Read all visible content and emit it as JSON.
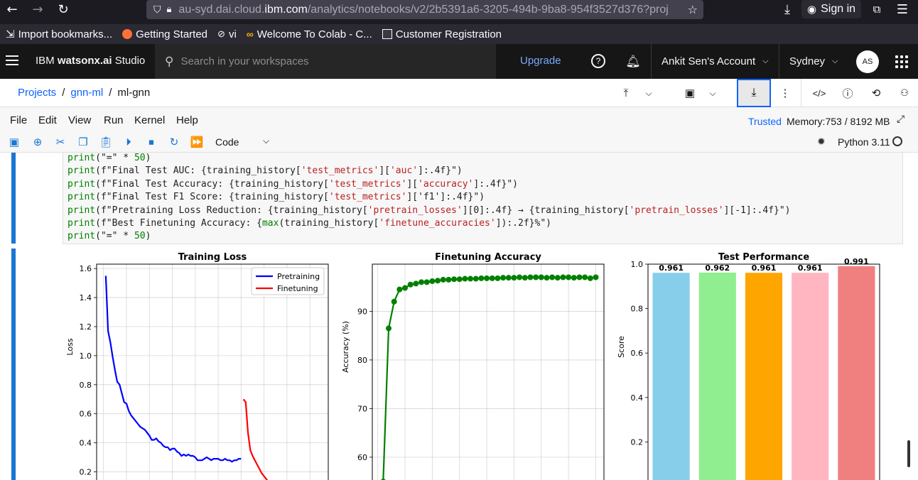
{
  "browser": {
    "url_host": "au-syd.dai.cloud.",
    "url_domain": "ibm.com",
    "url_path": "/analytics/notebooks/v2/2b5391a6-3205-494b-9ba8-954f3527d376?projec",
    "signin": "Sign in"
  },
  "bookmarks": [
    {
      "label": "Import bookmarks..."
    },
    {
      "label": "Getting Started"
    },
    {
      "label": "vi"
    },
    {
      "label": "Welcome To Colab - C..."
    },
    {
      "label": "Customer Registration"
    }
  ],
  "header": {
    "brand_prefix": "IBM ",
    "brand_bold": "watsonx.ai",
    "brand_suffix": " Studio",
    "search_placeholder": "Search in your workspaces",
    "upgrade": "Upgrade",
    "account": "Ankit Sen's Account",
    "region": "Sydney",
    "avatar": "AS"
  },
  "breadcrumb": {
    "items": [
      "Projects",
      "gnn-ml",
      "ml-gnn"
    ]
  },
  "menu": {
    "items": [
      "File",
      "Edit",
      "View",
      "Run",
      "Kernel",
      "Help"
    ],
    "trusted": "Trusted",
    "memory": "Memory:753 / 8192 MB"
  },
  "toolbar": {
    "cell_type": "Code",
    "kernel": "Python 3.11"
  },
  "code_lines": [
    "print(\"=\" * 50)",
    "print(f\"Final Test AUC: {training_history['test_metrics']['auc']:.4f}\")",
    "print(f\"Final Test Accuracy: {training_history['test_metrics']['accuracy']:.4f}\")",
    "print(f\"Final Test F1 Score: {training_history['test_metrics']['f1']:.4f}\")",
    "print(f\"Pretraining Loss Reduction: {training_history['pretrain_losses'][0]:.4f} → {training_history['pretrain_losses'][-1]:.4f}\")",
    "print(f\"Best Finetuning Accuracy: {max(training_history['finetune_accuracies']):.2f}%\")",
    "print(\"=\" * 50)"
  ],
  "chart_data": [
    {
      "type": "line",
      "title": "Training Loss",
      "ylabel": "Loss",
      "xlabel": "",
      "ylim": [
        0.1,
        1.63
      ],
      "yticks": [
        0.2,
        0.4,
        0.6,
        0.8,
        1.0,
        1.2,
        1.4,
        1.6
      ],
      "legend": "top-right",
      "grid": true,
      "series": [
        {
          "name": "Pretraining",
          "color": "#0000ff",
          "x": [
            1,
            2,
            3,
            4,
            5,
            6,
            7,
            8,
            9,
            10,
            11,
            12,
            13,
            14,
            15,
            16,
            17,
            18,
            19,
            20,
            21,
            22,
            23,
            24,
            25,
            26,
            27,
            28,
            29,
            30,
            31,
            32,
            33,
            34,
            35,
            36,
            37,
            38,
            39,
            40,
            41,
            42,
            43,
            44,
            45,
            46,
            47,
            48,
            49,
            50,
            51,
            52,
            53,
            54,
            55,
            56,
            57,
            58,
            59,
            60
          ],
          "values": [
            1.55,
            1.17,
            1.09,
            0.99,
            0.9,
            0.82,
            0.8,
            0.74,
            0.68,
            0.67,
            0.62,
            0.59,
            0.57,
            0.55,
            0.53,
            0.51,
            0.5,
            0.49,
            0.47,
            0.45,
            0.42,
            0.42,
            0.43,
            0.41,
            0.4,
            0.38,
            0.37,
            0.37,
            0.35,
            0.36,
            0.36,
            0.34,
            0.33,
            0.31,
            0.32,
            0.31,
            0.32,
            0.31,
            0.31,
            0.3,
            0.28,
            0.28,
            0.28,
            0.29,
            0.3,
            0.29,
            0.28,
            0.29,
            0.29,
            0.29,
            0.28,
            0.28,
            0.29,
            0.28,
            0.28,
            0.27,
            0.28,
            0.28,
            0.29,
            0.29
          ]
        },
        {
          "name": "Finetuning",
          "color": "#ff0000",
          "x": [
            61,
            62,
            63,
            64,
            65,
            66,
            67,
            68,
            69,
            70,
            71,
            72,
            73
          ],
          "values": [
            0.7,
            0.68,
            0.47,
            0.35,
            0.31,
            0.28,
            0.25,
            0.22,
            0.19,
            0.17,
            0.15,
            0.13,
            0.12
          ]
        }
      ]
    },
    {
      "type": "line",
      "title": "Finetuning Accuracy",
      "ylabel": "Accuracy (%)",
      "xlabel": "",
      "ylim": [
        54,
        99.7
      ],
      "yticks": [
        60,
        70,
        80,
        90
      ],
      "grid": true,
      "series": [
        {
          "name": "",
          "color": "#008000",
          "x": [
            1,
            2,
            3,
            4,
            5,
            6,
            7,
            8,
            9,
            10,
            11,
            12,
            13,
            14,
            15,
            16,
            17,
            18,
            19,
            20,
            21,
            22,
            23,
            24,
            25,
            26,
            27,
            28,
            29,
            30,
            31,
            32,
            33,
            34,
            35,
            36,
            37,
            38,
            39,
            40
          ],
          "values": [
            55.0,
            86.5,
            92.0,
            94.5,
            94.8,
            95.5,
            95.7,
            96.0,
            96.0,
            96.2,
            96.3,
            96.5,
            96.5,
            96.6,
            96.6,
            96.7,
            96.7,
            96.7,
            96.8,
            96.8,
            96.8,
            96.8,
            96.9,
            96.9,
            96.9,
            97.0,
            96.9,
            97.0,
            97.0,
            97.0,
            96.9,
            97.0,
            96.9,
            97.0,
            97.0,
            96.9,
            97.0,
            97.0,
            96.8,
            97.0
          ]
        }
      ]
    },
    {
      "type": "bar",
      "title": "Test Performance",
      "ylabel": "Score",
      "xlabel": "",
      "ylim": [
        0.0,
        1.0
      ],
      "yticks": [
        0.2,
        0.4,
        0.6,
        0.8,
        1.0
      ],
      "grid": false,
      "values": [
        0.961,
        0.962,
        0.961,
        0.961,
        0.991
      ],
      "labels": [
        "0.961",
        "0.962",
        "0.961",
        "0.961",
        "0.991"
      ],
      "colors": [
        "#87ceeb",
        "#90ee90",
        "#ffa500",
        "#ffb6c1",
        "#f08080"
      ]
    }
  ]
}
